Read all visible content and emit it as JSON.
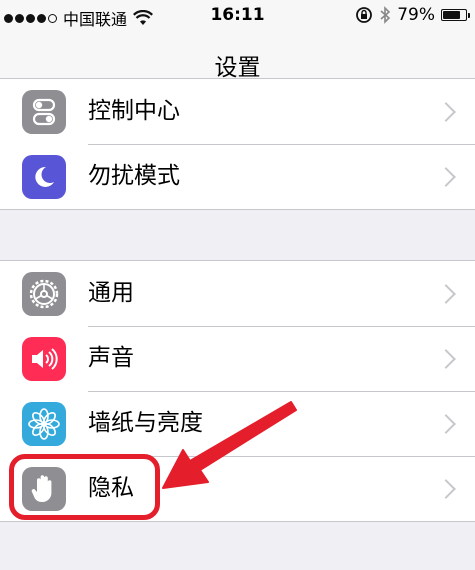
{
  "status_bar": {
    "carrier": "中国联通",
    "time": "16:11",
    "battery_percent": "79%",
    "battery_level": 0.79,
    "signal_bars_filled": 4,
    "signal_bars_total": 5
  },
  "nav": {
    "title": "设置"
  },
  "groups": [
    {
      "items": [
        {
          "label": "控制中心",
          "icon": "control-center-icon",
          "icon_color": "#8e8e93"
        },
        {
          "label": "勿扰模式",
          "icon": "moon-icon",
          "icon_color": "#5856d6"
        }
      ]
    },
    {
      "items": [
        {
          "label": "通用",
          "icon": "gear-icon",
          "icon_color": "#8e8e93"
        },
        {
          "label": "声音",
          "icon": "speaker-icon",
          "icon_color": "#ff2d55"
        },
        {
          "label": "墙纸与亮度",
          "icon": "flower-icon",
          "icon_color": "#34aadc"
        },
        {
          "label": "隐私",
          "icon": "hand-icon",
          "icon_color": "#8e8e93"
        }
      ]
    }
  ],
  "annotation": {
    "color": "#e41e2b",
    "target": "隐私"
  }
}
